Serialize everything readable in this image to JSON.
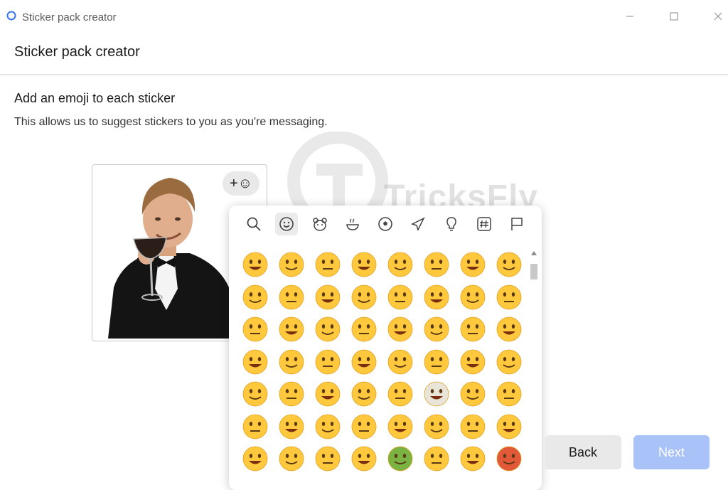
{
  "window": {
    "app_name": "Sticker pack creator"
  },
  "header": {
    "title": "Sticker pack creator"
  },
  "main": {
    "heading": "Add an emoji to each sticker",
    "subtext": "This allows us to suggest stickers to you as you're messaging."
  },
  "watermark": {
    "text": "TricksFly"
  },
  "sticker": {
    "add_emoji_label": "+☺"
  },
  "picker": {
    "categories": [
      "search-icon",
      "smiley-icon",
      "animal-icon",
      "food-icon",
      "sports-icon",
      "travel-icon",
      "objects-icon",
      "symbols-icon",
      "flags-icon"
    ],
    "active_category": "smiley-icon"
  },
  "footer": {
    "back_label": "Back",
    "next_label": "Next"
  },
  "colors": {
    "accent_disabled": "#a9c2f7",
    "emoji_face": "#ffc83d"
  }
}
